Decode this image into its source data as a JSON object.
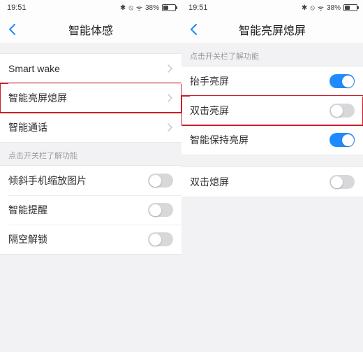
{
  "status": {
    "time": "19:51",
    "bluetooth": "⌥",
    "dnd": "⃠",
    "wifi": "ᯤ",
    "battery_pct": "38%"
  },
  "left": {
    "title": "智能体感",
    "nav": [
      {
        "label": "Smart wake"
      },
      {
        "label": "智能亮屏熄屏"
      },
      {
        "label": "智能通话"
      }
    ],
    "hint": "点击开关栏了解功能",
    "toggles": [
      {
        "label": "倾斜手机缩放图片",
        "on": false
      },
      {
        "label": "智能提醒",
        "on": false
      },
      {
        "label": "隔空解锁",
        "on": false
      }
    ]
  },
  "right": {
    "title": "智能亮屏熄屏",
    "hint": "点击开关栏了解功能",
    "group1": [
      {
        "label": "抬手亮屏",
        "on": true
      },
      {
        "label": "双击亮屏",
        "on": false
      },
      {
        "label": "智能保持亮屏",
        "on": true
      }
    ],
    "group2": [
      {
        "label": "双击熄屏",
        "on": false
      }
    ]
  }
}
